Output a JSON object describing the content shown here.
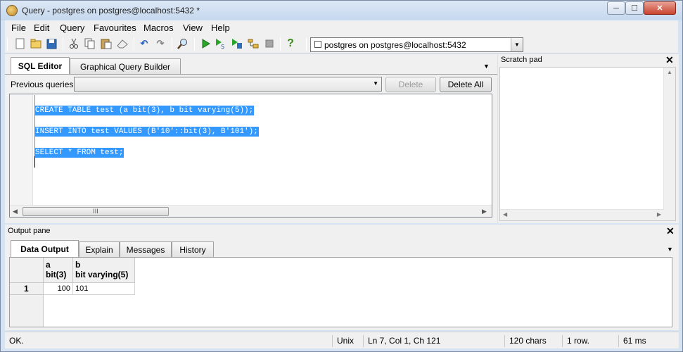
{
  "window": {
    "title": "Query - postgres on postgres@localhost:5432 *",
    "min_label": "─",
    "max_label": "☐",
    "close_label": "✕"
  },
  "menu": {
    "items": [
      "File",
      "Edit",
      "Query",
      "Favourites",
      "Macros",
      "View",
      "Help"
    ]
  },
  "toolbar": {
    "connection": "postgres on postgres@localhost:5432"
  },
  "editor": {
    "tabs": [
      "SQL Editor",
      "Graphical Query Builder"
    ],
    "previous_queries_label": "Previous queries",
    "delete_label": "Delete",
    "delete_all_label": "Delete All",
    "code_lines": [
      "CREATE TABLE test (a bit(3), b bit varying(5));",
      "INSERT INTO test VALUES (B'10'::bit(3), B'101');",
      "SELECT * FROM test;"
    ],
    "scroll_thumb_label": "III"
  },
  "scratch_pad": {
    "title": "Scratch pad"
  },
  "output": {
    "title": "Output pane",
    "tabs": [
      "Data Output",
      "Explain",
      "Messages",
      "History"
    ],
    "columns": [
      {
        "name": "a",
        "type": "bit(3)"
      },
      {
        "name": "b",
        "type": "bit varying(5)"
      }
    ],
    "rows": [
      {
        "num": "1",
        "cells": [
          "100",
          "101"
        ]
      }
    ]
  },
  "status": {
    "message": "OK.",
    "line_ending": "Unix",
    "position": "Ln 7, Col 1, Ch 121",
    "chars": "120 chars",
    "rows": "1 row.",
    "time": "61 ms"
  }
}
